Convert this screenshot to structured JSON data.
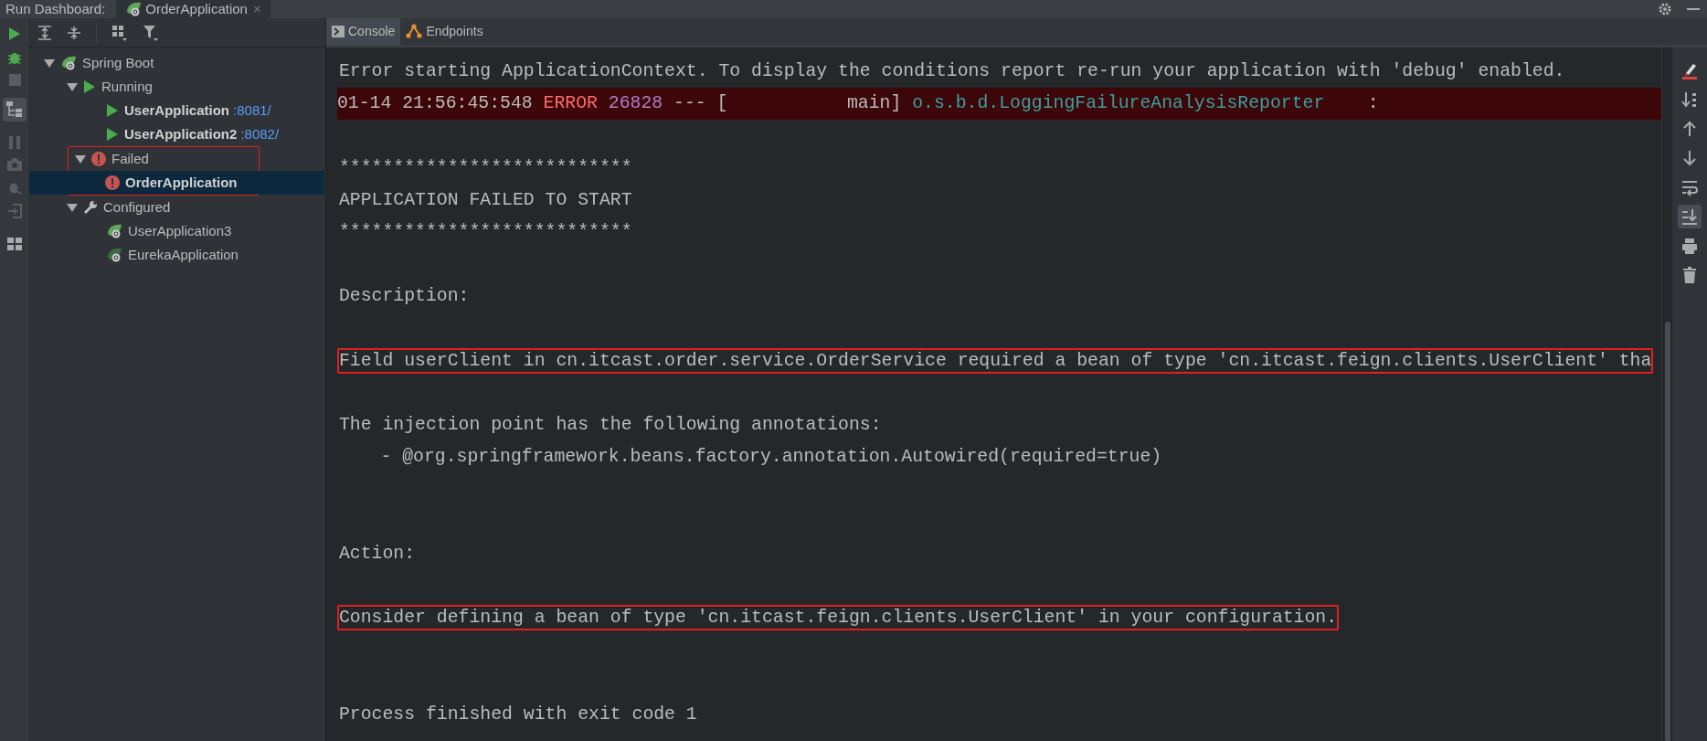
{
  "header": {
    "label": "Run Dashboard:",
    "tab": {
      "title": "OrderApplication",
      "close": "×",
      "selected": true
    }
  },
  "tree": [
    {
      "label": "Spring Boot",
      "kind": "spring",
      "expanded": true,
      "selected": false,
      "bold": false,
      "children": [
        {
          "label": "Running",
          "kind": "run",
          "expanded": true,
          "selected": false,
          "bold": false,
          "children": [
            {
              "label": "UserApplication",
              "port": ":8081/",
              "kind": "run",
              "selected": false,
              "bold": true
            },
            {
              "label": "UserApplication2",
              "port": ":8082/",
              "kind": "run",
              "selected": false,
              "bold": true
            }
          ]
        },
        {
          "label": "Failed",
          "kind": "error",
          "expanded": true,
          "selected": false,
          "bold": false,
          "highlighted": true,
          "children": [
            {
              "label": "OrderApplication",
              "kind": "error",
              "selected": true,
              "bold": true
            }
          ]
        },
        {
          "label": "Configured",
          "kind": "wrench",
          "expanded": true,
          "selected": false,
          "bold": false,
          "children": [
            {
              "label": "UserApplication3",
              "kind": "spring",
              "selected": false,
              "bold": false
            },
            {
              "label": "EurekaApplication",
              "kind": "spring-dim",
              "selected": false,
              "bold": false
            }
          ]
        }
      ]
    }
  ],
  "console_tabs": [
    {
      "label": "Console",
      "kind": "console",
      "selected": true
    },
    {
      "label": "Endpoints",
      "kind": "endpoints",
      "selected": false
    }
  ],
  "console_lines": [
    {
      "kind": "text",
      "text": "Error starting ApplicationContext. To display the conditions report re-run your application with 'debug' enabled.",
      "highlighted": false
    },
    {
      "kind": "log",
      "timestamp": "01-14 21:56:45:548",
      "level": "ERROR",
      "pid": "26828",
      "separator": "--- [",
      "thread": "main]",
      "logger": "o.s.b.d.LoggingFailureAnalysisReporter",
      "colon": ":"
    },
    {
      "kind": "blank"
    },
    {
      "kind": "text",
      "text": "***************************",
      "highlighted": false
    },
    {
      "kind": "text",
      "text": "APPLICATION FAILED TO START",
      "highlighted": false
    },
    {
      "kind": "text",
      "text": "***************************",
      "highlighted": false
    },
    {
      "kind": "blank"
    },
    {
      "kind": "text",
      "text": "Description:",
      "highlighted": false
    },
    {
      "kind": "blank"
    },
    {
      "kind": "text",
      "text": "Field userClient in cn.itcast.order.service.OrderService required a bean of type 'cn.itcast.feign.clients.UserClient' tha",
      "highlighted": true
    },
    {
      "kind": "blank"
    },
    {
      "kind": "text",
      "text": "The injection point has the following annotations:",
      "highlighted": false
    },
    {
      "kind": "text",
      "text": "\t- @org.springframework.beans.factory.annotation.Autowired(required=true)",
      "highlighted": false
    },
    {
      "kind": "blank"
    },
    {
      "kind": "blank"
    },
    {
      "kind": "text",
      "text": "Action:",
      "highlighted": false
    },
    {
      "kind": "blank"
    },
    {
      "kind": "text",
      "text": "Consider defining a bean of type 'cn.itcast.feign.clients.UserClient' in your configuration.",
      "highlighted": true
    },
    {
      "kind": "blank"
    },
    {
      "kind": "blank"
    },
    {
      "kind": "text",
      "text": "Process finished with exit code 1",
      "highlighted": false
    }
  ],
  "console_toolbar": [
    {
      "kind": "clear",
      "selected": false
    },
    {
      "kind": "sort",
      "selected": false
    },
    {
      "kind": "up",
      "selected": false
    },
    {
      "kind": "down",
      "selected": false
    },
    {
      "kind": "wrap",
      "selected": false
    },
    {
      "kind": "scroll-end",
      "selected": true
    },
    {
      "kind": "print",
      "selected": false
    },
    {
      "kind": "trash",
      "selected": false
    }
  ]
}
